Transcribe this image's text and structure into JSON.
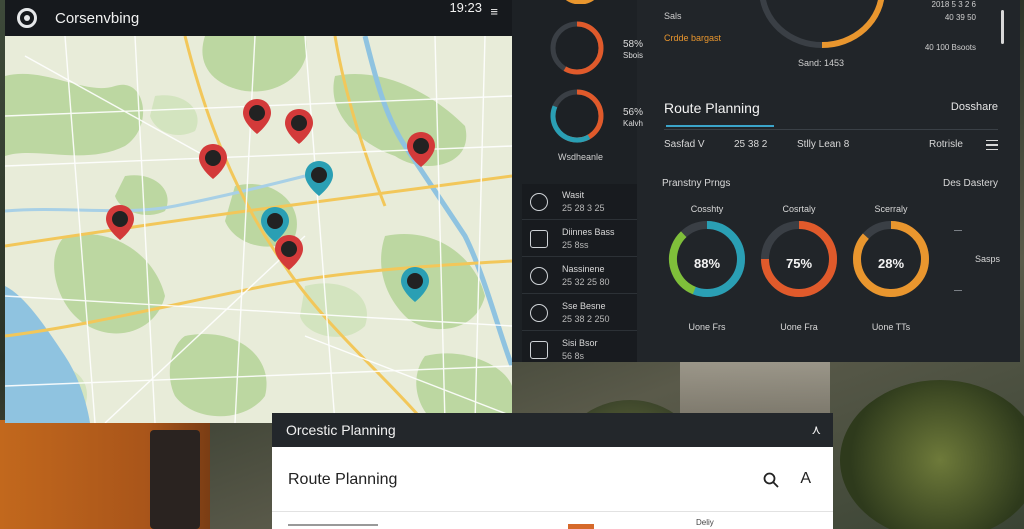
{
  "map_window": {
    "title": "Corsenvbing",
    "clock": "19:23",
    "menu_icon": "hamburger-icon",
    "markers": [
      {
        "icon": "pin-icon",
        "color": "#d33a3a"
      },
      {
        "icon": "pin-icon",
        "color": "#d33a3a"
      },
      {
        "icon": "pin-icon",
        "color": "#d33a3a"
      },
      {
        "icon": "pin-icon",
        "color": "#d33a3a"
      },
      {
        "icon": "pin-icon",
        "color": "#d33a3a"
      },
      {
        "icon": "pin-icon",
        "color": "#d33a3a"
      },
      {
        "icon": "pin-icon",
        "color": "#2a9fb4"
      },
      {
        "icon": "pin-icon",
        "color": "#2a9fb4"
      },
      {
        "icon": "pin-icon",
        "color": "#2a9fb4"
      }
    ]
  },
  "dashboard": {
    "left_rings": [
      {
        "value": "58%",
        "label": "Sbois",
        "color": "#e9962e",
        "percent": 0.58
      },
      {
        "value": "56%",
        "label": "Kalvh",
        "color": "#2a9fb4",
        "percent": 0.56
      }
    ],
    "ring_caption": "Wsdheanle",
    "list": [
      {
        "title": "Wasit",
        "sub": "25 28 3 25",
        "icon": "clock-icon"
      },
      {
        "title": "Diinnes Bass",
        "sub": "25 8ss",
        "icon": "calendar-icon"
      },
      {
        "title": "Nassinene",
        "sub": "25 32 25 80",
        "icon": "target-icon"
      },
      {
        "title": "Sse Besne",
        "sub": "25 38 2 250",
        "icon": "pin-icon"
      },
      {
        "title": "Sisi Bsor",
        "sub": "56 8s",
        "icon": "truck-icon"
      }
    ],
    "top_labels": {
      "sals": "Sals",
      "budget": "Crdde bargast",
      "center_caption": "Sand: 1453",
      "right_1": "2018 5 3 2 6",
      "right_2": "40 39 50",
      "right_3": "40 100 Bsoots"
    },
    "route_title": "Route Planning",
    "route_right": "Dosshare",
    "filters": {
      "sort": "Sasfad V",
      "dist": "25 38 2",
      "date": "Stlly Lean 8",
      "route": "Rotrisle"
    },
    "section_left": "Pranstny Prngs",
    "section_right": "Des Dastery",
    "gauges": [
      {
        "caption": "Cosshty",
        "value": "88%",
        "foot": "Uone Frs",
        "color": "#2a9fb4",
        "accent": "#7fbf3a",
        "percent": 0.88
      },
      {
        "caption": "Cosrtaly",
        "value": "75%",
        "foot": "Uone Fra",
        "color": "#e05a2b",
        "accent": "#e05a2b",
        "percent": 0.75
      },
      {
        "caption": "Scerraly",
        "value": "28%",
        "foot": "Uone TTs",
        "color": "#e9962e",
        "accent": "#e9962e",
        "percent": 0.28
      }
    ],
    "side_label": "Sasps"
  },
  "dialog": {
    "header": "Orcestic Planning",
    "collapse_icon": "chevron-up-icon",
    "title": "Route Planning",
    "search_icon": "search-icon",
    "action_letter": "A",
    "foot": "Deliy"
  }
}
